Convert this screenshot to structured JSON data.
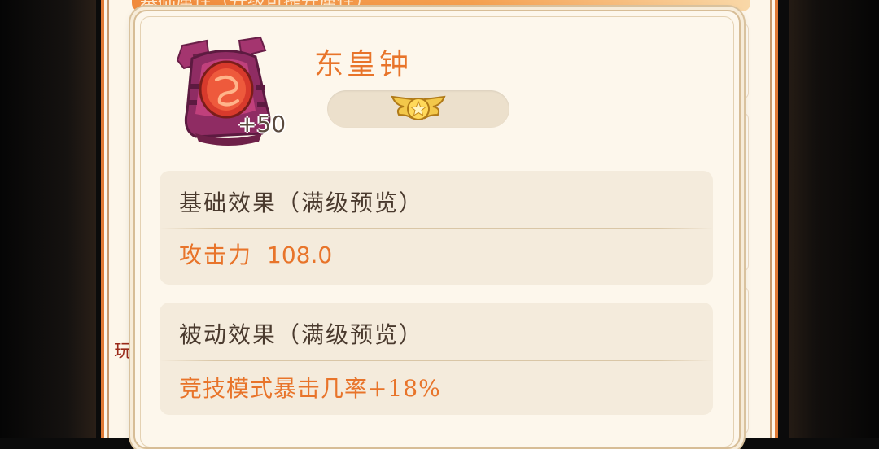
{
  "background": {
    "header_text": "基础属性（升级可提升属性）",
    "side_text": "玩"
  },
  "item": {
    "name": "东皇钟",
    "level": "+50",
    "icon": "bell-icon",
    "rank_icon": "winged-star-badge-icon"
  },
  "sections": {
    "base": {
      "title": "基础效果（满级预览）",
      "stat_name": "攻击力",
      "stat_value": "108.0"
    },
    "passive": {
      "title": "被动效果（满级预览）",
      "text": "竞技模式暴击几率+18%"
    }
  },
  "colors": {
    "accent": "#e8742a",
    "frame": "#e07a35",
    "panel": "#fdf7ec",
    "section_bg": "#f4ebdc",
    "text_dark": "#4a3a2e"
  }
}
